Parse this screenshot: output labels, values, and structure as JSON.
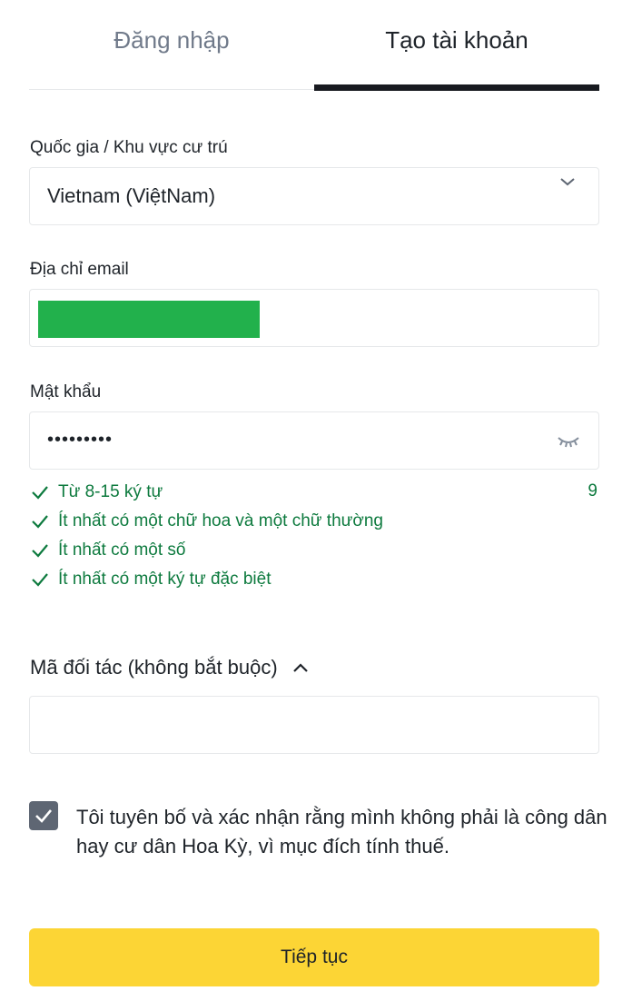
{
  "tabs": {
    "login": "Đăng nhập",
    "create_account": "Tạo tài khoản",
    "active": "create_account"
  },
  "country": {
    "label": "Quốc gia / Khu vực cư trú",
    "value": "Vietnam (ViệtNam)",
    "icon": "chevron-down-icon"
  },
  "email": {
    "label": "Địa chỉ email",
    "value": "",
    "redacted": true
  },
  "password": {
    "label": "Mật khẩu",
    "masked_value": "•••••••••",
    "length_count": "9",
    "icon": "eye-closed-icon",
    "rules": [
      "Từ 8-15 ký tự",
      "Ít nhất có một chữ hoa và một chữ thường",
      "Ít nhất có một số",
      "Ít nhất có một ký tự đặc biệt"
    ],
    "rules_satisfied": [
      true,
      true,
      true,
      true
    ]
  },
  "partner": {
    "label": "Mã đối tác (không bắt buộc)",
    "value": "",
    "expanded": true,
    "icon": "chevron-up-icon"
  },
  "declaration": {
    "checked": true,
    "text": "Tôi tuyên bố và xác nhận rằng mình không phải là công dân hay cư dân Hoa Kỳ, vì mục đích tính thuế."
  },
  "continue_button": {
    "label": "Tiếp tục"
  },
  "colors": {
    "accent": "#fcd535",
    "success": "#0d7a3e",
    "redaction": "#22b14c",
    "checkbox": "#5e6673"
  }
}
